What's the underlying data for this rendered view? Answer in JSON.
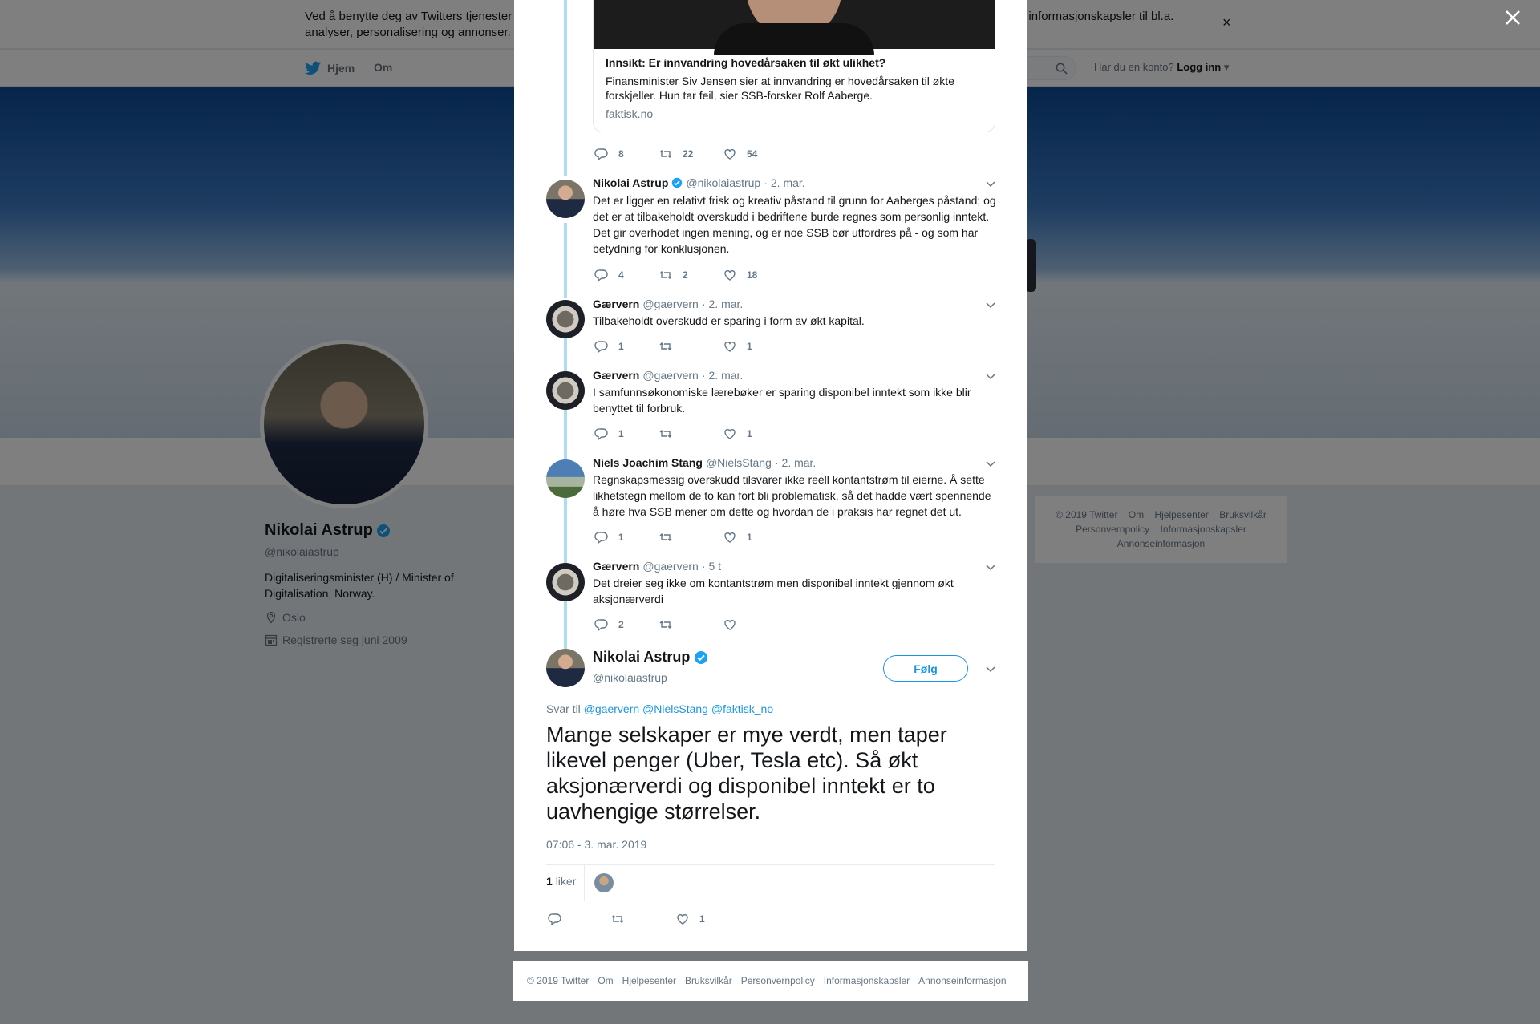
{
  "cookie_banner": {
    "text": "Ved å benytte deg av Twitters tjenester samtykker du i vår bruk av informasjonskapsler. Vi og våre partnere opererer globalt og benytter informasjonskapsler til bl.a. analyser, personalisering og annonser."
  },
  "nav": {
    "home": "Hjem",
    "about": "Om",
    "account_prompt": "Har du en konto?",
    "login": "Logg inn"
  },
  "profile": {
    "name": "Nikolai Astrup",
    "handle": "@nikolaiastrup",
    "bio": "Digitaliseringsminister (H) / Minister of Digitalisation, Norway.",
    "location": "Oslo",
    "joined": "Registrerte seg juni 2009"
  },
  "side_footer": {
    "items": [
      "© 2019 Twitter",
      "Om",
      "Hjelpesenter",
      "Bruksvilkår",
      "Personvernpolicy",
      "Informasjonskapsler",
      "Annonseinformasjon"
    ]
  },
  "card": {
    "title": "Innsikt: Er innvandring hovedårsaken til økt ulikhet?",
    "description": "Finansminister Siv Jensen sier at innvandring er hovedårsaken til økte forskjeller. Hun tar feil, sier SSB-forsker Rolf Aaberge.",
    "domain": "faktisk.no",
    "replies": "8",
    "retweets": "22",
    "likes": "54"
  },
  "tweets": [
    {
      "name": "Nikolai Astrup",
      "verified": true,
      "handle": "@nikolaiastrup",
      "time": "2. mar.",
      "text": "Det er ligger en relativt frisk og kreativ påstand til grunn for Aaberges påstand; og det er at tilbakeholdt overskudd i bedriftene burde regnes som personlig inntekt. Det gir overhodet ingen mening, og er noe SSB bør utfordres på - og som har betydning for konklusjonen.",
      "replies": "4",
      "retweets": "2",
      "likes": "18"
    },
    {
      "name": "Gærvern",
      "verified": false,
      "handle": "@gaervern",
      "time": "2. mar.",
      "text": "Tilbakeholdt overskudd er sparing i form av økt kapital.",
      "replies": "1",
      "retweets": "",
      "likes": "1"
    },
    {
      "name": "Gærvern",
      "verified": false,
      "handle": "@gaervern",
      "time": "2. mar.",
      "text": "I samfunnsøkonomiske lærebøker er sparing disponibel inntekt som ikke blir benyttet til forbruk.",
      "replies": "1",
      "retweets": "",
      "likes": "1"
    },
    {
      "name": "Niels Joachim Stang",
      "verified": false,
      "handle": "@NielsStang",
      "time": "2. mar.",
      "text": "Regnskapsmessig overskudd tilsvarer ikke reell kontantstrøm til eierne. Å sette likhetstegn mellom de to kan fort bli problematisk, så det hadde vært spennende å høre hva SSB mener om dette og hvordan de i praksis har regnet det ut.",
      "replies": "1",
      "retweets": "",
      "likes": "1"
    },
    {
      "name": "Gærvern",
      "verified": false,
      "handle": "@gaervern",
      "time": "5 t",
      "text": "Det dreier seg ikke om kontantstrøm men disponibel inntekt gjennom økt aksjonærverdi",
      "replies": "2",
      "retweets": "",
      "likes": ""
    }
  ],
  "main_tweet": {
    "name": "Nikolai Astrup",
    "handle": "@nikolaiastrup",
    "follow": "Følg",
    "reply_prefix": "Svar til",
    "reply_mentions": [
      "@gaervern",
      "@NielsStang",
      "@faktisk_no"
    ],
    "text": "Mange selskaper er mye verdt, men taper likevel penger (Uber, Tesla etc). Så økt aksjonærverdi og disponibel inntekt er to uavhengige størrelser.",
    "timestamp": "07:06 - 3. mar. 2019",
    "like_count": "1",
    "like_label": "liker",
    "replies": "",
    "retweets": "",
    "likes": "1"
  },
  "modal_footer": {
    "items": [
      "© 2019 Twitter",
      "Om",
      "Hjelpesenter",
      "Bruksvilkår",
      "Personvernpolicy",
      "Informasjonskapsler",
      "Annonseinformasjon"
    ]
  },
  "colors": {
    "accent": "#1b95e0",
    "thread_line": "#aeddef",
    "verified": "#1da1f2"
  }
}
